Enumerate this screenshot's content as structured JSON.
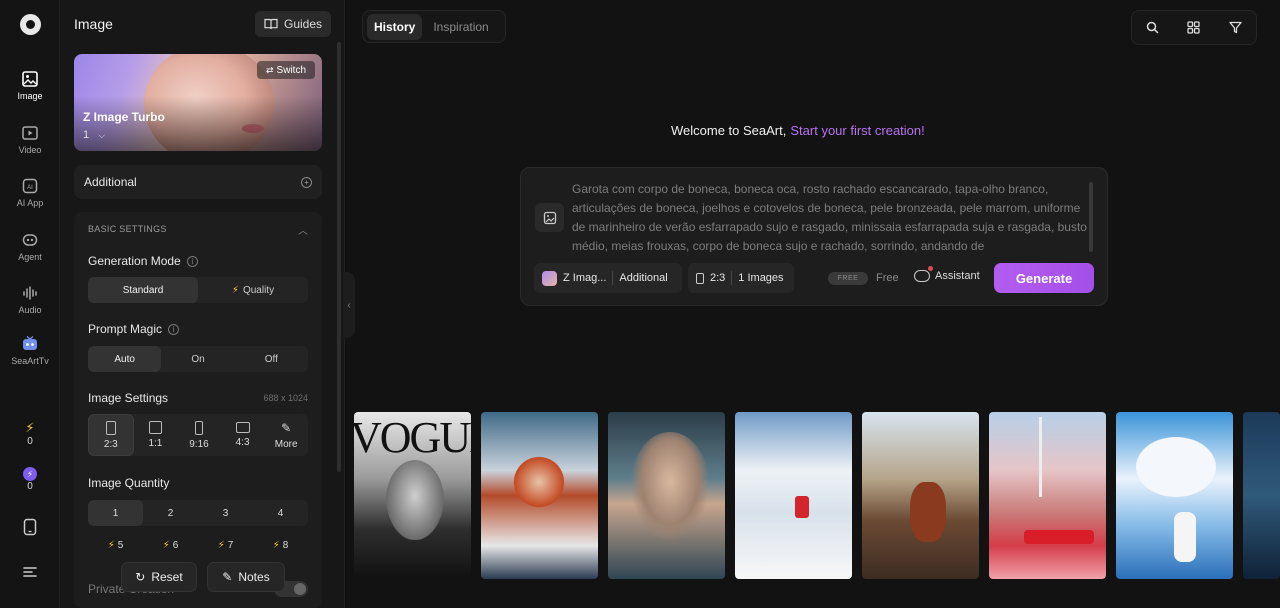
{
  "rail": {
    "items": [
      {
        "label": "Image",
        "icon": "image-icon"
      },
      {
        "label": "Video",
        "icon": "video-icon"
      },
      {
        "label": "AI App",
        "icon": "ai-app-icon"
      },
      {
        "label": "Agent",
        "icon": "agent-icon"
      },
      {
        "label": "Audio",
        "icon": "audio-icon"
      },
      {
        "label": "SeaArtTv",
        "icon": "tv-icon"
      }
    ],
    "stamina": "0",
    "credits": "0"
  },
  "panel": {
    "title": "Image",
    "guides_label": "Guides",
    "model": {
      "name": "Z Image Turbo",
      "version": "1",
      "switch_label": "Switch"
    },
    "additional_label": "Additional",
    "basic_settings": "BASIC SETTINGS",
    "generation_mode": {
      "label": "Generation Mode",
      "options": [
        "Standard",
        "Quality"
      ],
      "selected": "Standard"
    },
    "prompt_magic": {
      "label": "Prompt Magic",
      "options": [
        "Auto",
        "On",
        "Off"
      ],
      "selected": "Auto"
    },
    "image_settings": {
      "label": "Image Settings",
      "dims": "688 x 1024",
      "sizes": [
        "2:3",
        "1:1",
        "9:16",
        "4:3",
        "More"
      ],
      "selected": "2:3"
    },
    "image_quantity": {
      "label": "Image Quantity",
      "row1": [
        "1",
        "2",
        "3",
        "4"
      ],
      "row2": [
        "5",
        "6",
        "7",
        "8"
      ],
      "selected": "1"
    },
    "private_label": "Private Creation",
    "reset_label": "Reset",
    "notes_label": "Notes"
  },
  "tabs": [
    "History",
    "Inspiration"
  ],
  "welcome": {
    "text": "Welcome to SeaArt,",
    "accent": "Start your first creation!"
  },
  "prompt": {
    "text": "Garota com corpo de boneca, boneca oca, rosto rachado escancarado, tapa-olho branco, articulações de boneca, joelhos e cotovelos de boneca, pele bronzeada, pele marrom, uniforme de marinheiro de verão esfarrapado sujo e rasgado, minissaia esfarrapada suja e rasgada, busto médio, meias frouxas, corpo de boneca sujo e rachado, sorrindo, andando de",
    "model_short": "Z Imag...",
    "additional": "Additional",
    "ratio": "2:3",
    "images": "1 Images",
    "free_badge": "FREE",
    "free_label": "Free",
    "assistant_label": "Assistant",
    "generate_label": "Generate"
  },
  "gallery": {
    "vogue_text": "VOGUE"
  },
  "colors": {
    "accent": "#b35cf0",
    "bg": "#121212",
    "panel": "#171717"
  }
}
